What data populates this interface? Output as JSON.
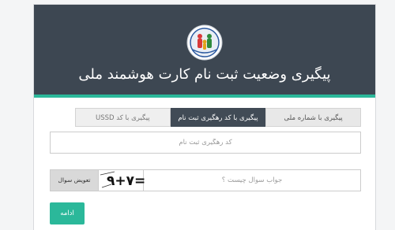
{
  "header": {
    "title": "پیگیری وضعیت ثبت نام کارت هوشمند ملی",
    "logo_icon": "national-registration-logo-icon"
  },
  "tabs": [
    {
      "label": "پیگیری با شماره ملی",
      "active": false
    },
    {
      "label": "پیگیری با کد رهگیری ثبت نام",
      "active": true
    },
    {
      "label": "پیگیری با کد USSD",
      "active": false
    }
  ],
  "tracking_input": {
    "placeholder": "کد رهگیری ثبت نام",
    "value": ""
  },
  "captcha": {
    "image_text": "۹+۷=",
    "answer_placeholder": "جواب سوال چیست ؟",
    "answer_value": "",
    "change_label": "تعویض سوال"
  },
  "continue_button": {
    "label": "ادامه"
  },
  "colors": {
    "header_bg": "#3d4752",
    "accent": "#2bb89a",
    "active_tab": "#414b56"
  }
}
